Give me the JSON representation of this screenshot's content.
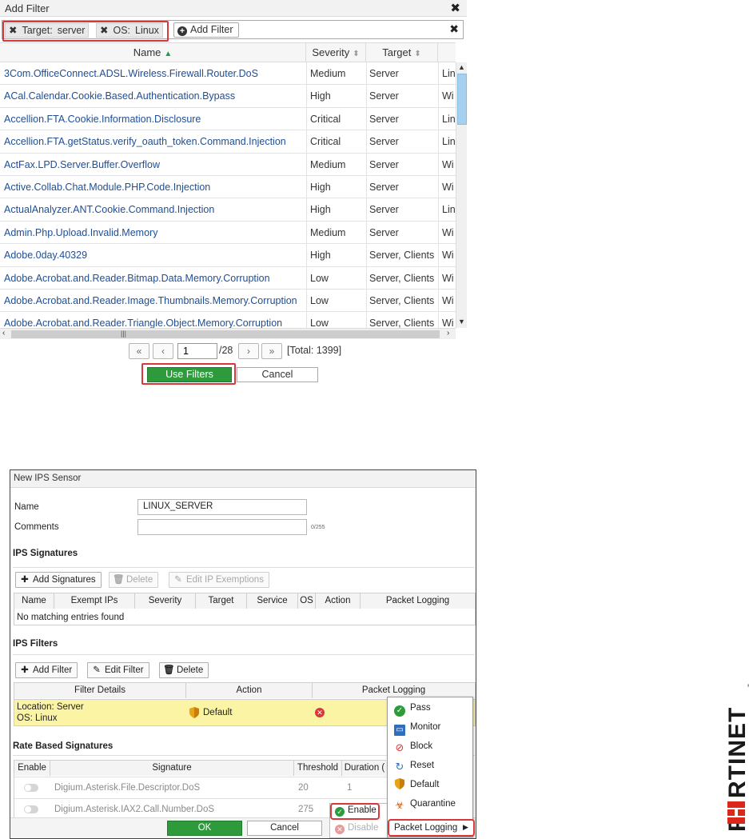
{
  "add_filter_dialog": {
    "title": "Add Filter",
    "close_glyph": "✖",
    "active_filters": [
      {
        "key": "Target:",
        "value": "server"
      },
      {
        "key": "OS:",
        "value": "Linux"
      }
    ],
    "add_filter_label": "Add Filter",
    "clear_glyph": "✖",
    "columns": {
      "name": "Name",
      "severity": "Severity",
      "target": "Target"
    },
    "rows": [
      {
        "name": "3Com.OfficeConnect.ADSL.Wireless.Firewall.Router.DoS",
        "severity": "Medium",
        "target": "Server",
        "os": "Lin"
      },
      {
        "name": "ACal.Calendar.Cookie.Based.Authentication.Bypass",
        "severity": "High",
        "target": "Server",
        "os": "Wi"
      },
      {
        "name": "Accellion.FTA.Cookie.Information.Disclosure",
        "severity": "Critical",
        "target": "Server",
        "os": "Lin"
      },
      {
        "name": "Accellion.FTA.getStatus.verify_oauth_token.Command.Injection",
        "severity": "Critical",
        "target": "Server",
        "os": "Lin"
      },
      {
        "name": "ActFax.LPD.Server.Buffer.Overflow",
        "severity": "Medium",
        "target": "Server",
        "os": "Wi"
      },
      {
        "name": "Active.Collab.Chat.Module.PHP.Code.Injection",
        "severity": "High",
        "target": "Server",
        "os": "Wi"
      },
      {
        "name": "ActualAnalyzer.ANT.Cookie.Command.Injection",
        "severity": "High",
        "target": "Server",
        "os": "Lin"
      },
      {
        "name": "Admin.Php.Upload.Invalid.Memory",
        "severity": "Medium",
        "target": "Server",
        "os": "Wi"
      },
      {
        "name": "Adobe.0day.40329",
        "severity": "High",
        "target": "Server, Clients",
        "os": "Wi"
      },
      {
        "name": "Adobe.Acrobat.and.Reader.Bitmap.Data.Memory.Corruption",
        "severity": "Low",
        "target": "Server, Clients",
        "os": "Wi"
      },
      {
        "name": "Adobe.Acrobat.and.Reader.Image.Thumbnails.Memory.Corruption",
        "severity": "Low",
        "target": "Server, Clients",
        "os": "Wi"
      },
      {
        "name": "Adobe.Acrobat.and.Reader.Triangle.Object.Memory.Corruption",
        "severity": "Low",
        "target": "Server, Clients",
        "os": "Wi"
      }
    ],
    "pager": {
      "first": "«",
      "prev": "‹",
      "next": "›",
      "last": "»",
      "page": "1",
      "of_pages": "/28",
      "total": "[Total: 1399]"
    },
    "use_filters_label": "Use Filters",
    "cancel_label": "Cancel"
  },
  "ips_sensor_dialog": {
    "title": "New IPS Sensor",
    "name_label": "Name",
    "name_value": "LINUX_SERVER",
    "comments_label": "Comments",
    "comments_counter": "0/255",
    "signatures_section": "IPS Signatures",
    "add_signatures_label": "Add Signatures",
    "delete_label": "Delete",
    "edit_ip_exemptions_label": "Edit IP Exemptions",
    "signature_columns": [
      "Name",
      "Exempt IPs",
      "Severity",
      "Target",
      "Service",
      "OS",
      "Action",
      "Packet Logging"
    ],
    "no_entries": "No matching entries found",
    "filters_section": "IPS Filters",
    "add_filter_label": "Add Filter",
    "edit_filter_label": "Edit Filter",
    "filter_delete_label": "Delete",
    "filter_columns": [
      "Filter Details",
      "Action",
      "Packet Logging"
    ],
    "filter_row": {
      "location": "Location: Server",
      "os": "OS: Linux",
      "action": "Default"
    },
    "rate_section": "Rate Based Signatures",
    "rate_columns": [
      "Enable",
      "Signature",
      "Threshold",
      "Duration ("
    ],
    "rate_rows": [
      {
        "signature": "Digium.Asterisk.File.Descriptor.DoS",
        "threshold": "20",
        "duration": "1"
      },
      {
        "signature": "Digium.Asterisk.IAX2.Call.Number.DoS",
        "threshold": "275",
        "duration": ""
      }
    ],
    "ok_label": "OK",
    "cancel_label": "Cancel",
    "enable_label": "Enable",
    "disable_label": "Disable",
    "context_menu": [
      "Pass",
      "Monitor",
      "Block",
      "Reset",
      "Default",
      "Quarantine"
    ],
    "packet_logging_label": "Packet Logging"
  },
  "colors": {
    "accent_green": "#2d9a3c",
    "highlight_red": "#d9373a",
    "link_blue": "#1f4e94",
    "selected_row_yellow": "#fbf4a4",
    "logo_red": "#da291c"
  }
}
